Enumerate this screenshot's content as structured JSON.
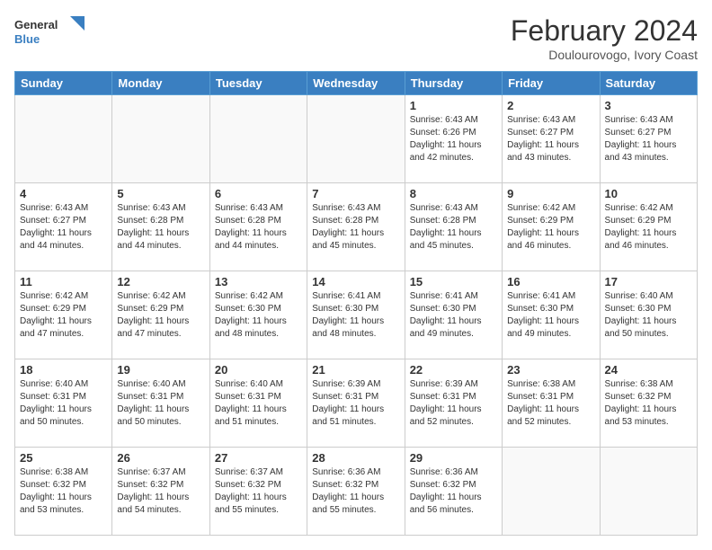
{
  "header": {
    "logo_line1": "General",
    "logo_line2": "Blue",
    "title": "February 2024",
    "subtitle": "Doulourovogo, Ivory Coast"
  },
  "weekdays": [
    "Sunday",
    "Monday",
    "Tuesday",
    "Wednesday",
    "Thursday",
    "Friday",
    "Saturday"
  ],
  "weeks": [
    [
      {
        "day": "",
        "info": ""
      },
      {
        "day": "",
        "info": ""
      },
      {
        "day": "",
        "info": ""
      },
      {
        "day": "",
        "info": ""
      },
      {
        "day": "1",
        "info": "Sunrise: 6:43 AM\nSunset: 6:26 PM\nDaylight: 11 hours\nand 42 minutes."
      },
      {
        "day": "2",
        "info": "Sunrise: 6:43 AM\nSunset: 6:27 PM\nDaylight: 11 hours\nand 43 minutes."
      },
      {
        "day": "3",
        "info": "Sunrise: 6:43 AM\nSunset: 6:27 PM\nDaylight: 11 hours\nand 43 minutes."
      }
    ],
    [
      {
        "day": "4",
        "info": "Sunrise: 6:43 AM\nSunset: 6:27 PM\nDaylight: 11 hours\nand 44 minutes."
      },
      {
        "day": "5",
        "info": "Sunrise: 6:43 AM\nSunset: 6:28 PM\nDaylight: 11 hours\nand 44 minutes."
      },
      {
        "day": "6",
        "info": "Sunrise: 6:43 AM\nSunset: 6:28 PM\nDaylight: 11 hours\nand 44 minutes."
      },
      {
        "day": "7",
        "info": "Sunrise: 6:43 AM\nSunset: 6:28 PM\nDaylight: 11 hours\nand 45 minutes."
      },
      {
        "day": "8",
        "info": "Sunrise: 6:43 AM\nSunset: 6:28 PM\nDaylight: 11 hours\nand 45 minutes."
      },
      {
        "day": "9",
        "info": "Sunrise: 6:42 AM\nSunset: 6:29 PM\nDaylight: 11 hours\nand 46 minutes."
      },
      {
        "day": "10",
        "info": "Sunrise: 6:42 AM\nSunset: 6:29 PM\nDaylight: 11 hours\nand 46 minutes."
      }
    ],
    [
      {
        "day": "11",
        "info": "Sunrise: 6:42 AM\nSunset: 6:29 PM\nDaylight: 11 hours\nand 47 minutes."
      },
      {
        "day": "12",
        "info": "Sunrise: 6:42 AM\nSunset: 6:29 PM\nDaylight: 11 hours\nand 47 minutes."
      },
      {
        "day": "13",
        "info": "Sunrise: 6:42 AM\nSunset: 6:30 PM\nDaylight: 11 hours\nand 48 minutes."
      },
      {
        "day": "14",
        "info": "Sunrise: 6:41 AM\nSunset: 6:30 PM\nDaylight: 11 hours\nand 48 minutes."
      },
      {
        "day": "15",
        "info": "Sunrise: 6:41 AM\nSunset: 6:30 PM\nDaylight: 11 hours\nand 49 minutes."
      },
      {
        "day": "16",
        "info": "Sunrise: 6:41 AM\nSunset: 6:30 PM\nDaylight: 11 hours\nand 49 minutes."
      },
      {
        "day": "17",
        "info": "Sunrise: 6:40 AM\nSunset: 6:30 PM\nDaylight: 11 hours\nand 50 minutes."
      }
    ],
    [
      {
        "day": "18",
        "info": "Sunrise: 6:40 AM\nSunset: 6:31 PM\nDaylight: 11 hours\nand 50 minutes."
      },
      {
        "day": "19",
        "info": "Sunrise: 6:40 AM\nSunset: 6:31 PM\nDaylight: 11 hours\nand 50 minutes."
      },
      {
        "day": "20",
        "info": "Sunrise: 6:40 AM\nSunset: 6:31 PM\nDaylight: 11 hours\nand 51 minutes."
      },
      {
        "day": "21",
        "info": "Sunrise: 6:39 AM\nSunset: 6:31 PM\nDaylight: 11 hours\nand 51 minutes."
      },
      {
        "day": "22",
        "info": "Sunrise: 6:39 AM\nSunset: 6:31 PM\nDaylight: 11 hours\nand 52 minutes."
      },
      {
        "day": "23",
        "info": "Sunrise: 6:38 AM\nSunset: 6:31 PM\nDaylight: 11 hours\nand 52 minutes."
      },
      {
        "day": "24",
        "info": "Sunrise: 6:38 AM\nSunset: 6:32 PM\nDaylight: 11 hours\nand 53 minutes."
      }
    ],
    [
      {
        "day": "25",
        "info": "Sunrise: 6:38 AM\nSunset: 6:32 PM\nDaylight: 11 hours\nand 53 minutes."
      },
      {
        "day": "26",
        "info": "Sunrise: 6:37 AM\nSunset: 6:32 PM\nDaylight: 11 hours\nand 54 minutes."
      },
      {
        "day": "27",
        "info": "Sunrise: 6:37 AM\nSunset: 6:32 PM\nDaylight: 11 hours\nand 55 minutes."
      },
      {
        "day": "28",
        "info": "Sunrise: 6:36 AM\nSunset: 6:32 PM\nDaylight: 11 hours\nand 55 minutes."
      },
      {
        "day": "29",
        "info": "Sunrise: 6:36 AM\nSunset: 6:32 PM\nDaylight: 11 hours\nand 56 minutes."
      },
      {
        "day": "",
        "info": ""
      },
      {
        "day": "",
        "info": ""
      }
    ]
  ]
}
